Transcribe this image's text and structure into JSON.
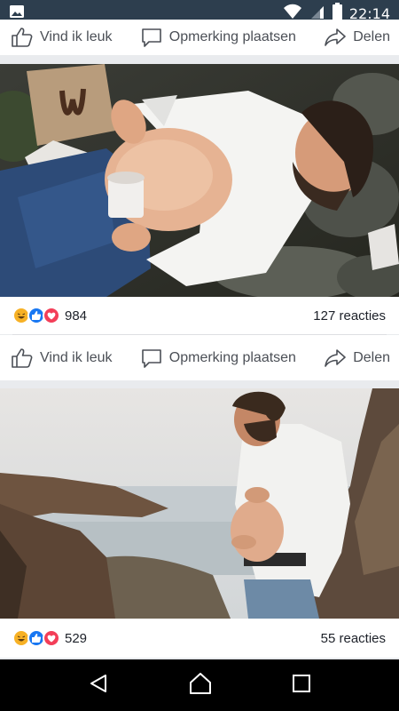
{
  "status_bar": {
    "time": "22:14",
    "icons": [
      "image-icon",
      "wifi-icon",
      "signal-icon",
      "battery-icon"
    ]
  },
  "post1": {
    "actions": {
      "like": "Vind ik leuk",
      "comment": "Opmerking plaatsen",
      "share": "Delen"
    }
  },
  "post2": {
    "reaction_count": "984",
    "comments": "127 reacties",
    "reaction_icons": [
      "haha-icon",
      "like-icon",
      "love-icon"
    ],
    "actions": {
      "like": "Vind ik leuk",
      "comment": "Opmerking plaatsen",
      "share": "Delen"
    }
  },
  "post3": {
    "reaction_count": "529",
    "comments": "55 reacties",
    "reaction_icons": [
      "haha-icon",
      "like-icon",
      "love-icon"
    ]
  },
  "nav": {
    "buttons": [
      "back-icon",
      "home-icon",
      "recents-icon"
    ]
  },
  "colors": {
    "status_bar": "#2d3e4e",
    "like_blue": "#1877f2",
    "love_red": "#f33e58",
    "haha_yellow": "#f7b125"
  }
}
